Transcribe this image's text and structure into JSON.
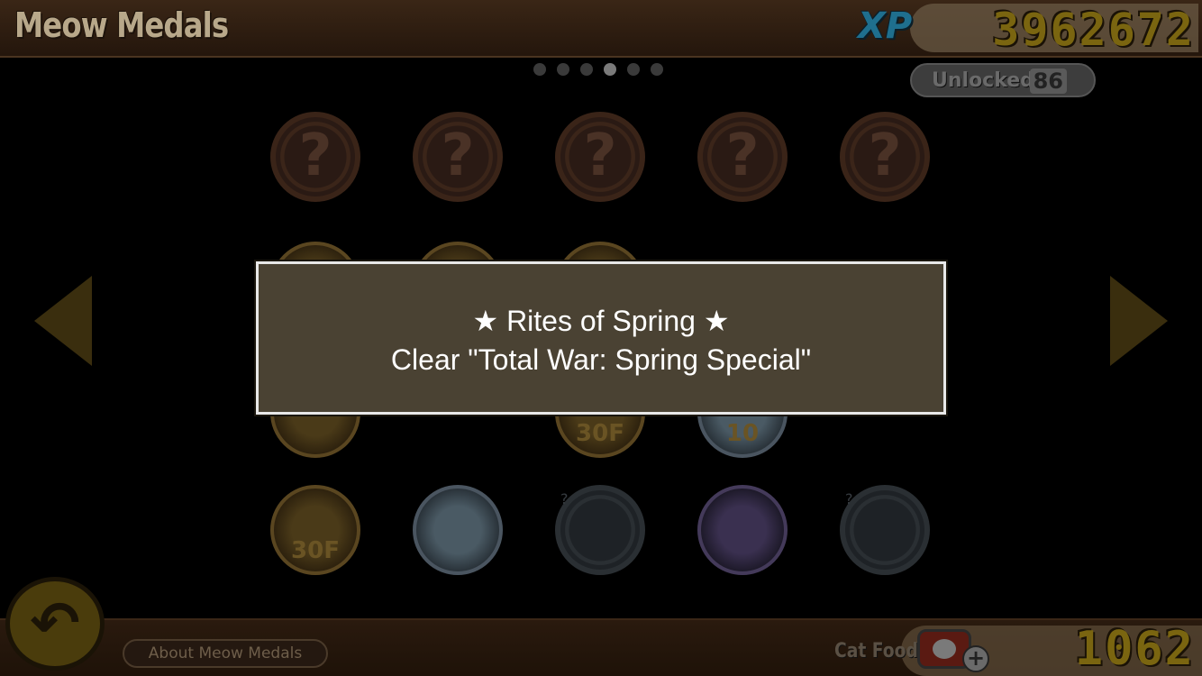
{
  "header": {
    "title": "Meow Medals",
    "xp_label": "XP",
    "xp_value": "3962672"
  },
  "pager": {
    "pages": 6,
    "active_index": 3
  },
  "unlocked": {
    "label": "Unlocked",
    "count": "86"
  },
  "medals": [
    {
      "state": "locked",
      "symbol": "?"
    },
    {
      "state": "locked",
      "symbol": "?"
    },
    {
      "state": "locked",
      "symbol": "?"
    },
    {
      "state": "locked",
      "symbol": "?"
    },
    {
      "state": "locked",
      "symbol": "?"
    },
    {
      "state": "gold",
      "symbol": ""
    },
    {
      "state": "gold",
      "symbol": ""
    },
    {
      "state": "gold",
      "symbol": ""
    },
    {
      "state": "hidden",
      "symbol": ""
    },
    {
      "state": "hidden",
      "symbol": ""
    },
    {
      "state": "gold",
      "symbol": ""
    },
    {
      "state": "hidden",
      "symbol": ""
    },
    {
      "state": "gold",
      "symbol": "30F"
    },
    {
      "state": "silver",
      "symbol": "10"
    },
    {
      "state": "hidden",
      "symbol": ""
    },
    {
      "state": "gold",
      "symbol": "30F"
    },
    {
      "state": "silver",
      "symbol": ""
    },
    {
      "state": "gray",
      "symbol": "?"
    },
    {
      "state": "purple",
      "symbol": ""
    },
    {
      "state": "gray",
      "symbol": "?"
    }
  ],
  "dialog": {
    "title": "★ Rites of Spring ★",
    "description": "Clear \"Total War: Spring Special\""
  },
  "footer": {
    "about_label": "About Meow Medals",
    "cat_food_label": "Cat Food",
    "cat_food_value": "1062",
    "plus_symbol": "+",
    "back_symbol": "↶"
  },
  "colors": {
    "accent_gold": "#7a6510",
    "xp_blue": "#1f6f8e",
    "dialog_bg": "#4a4233",
    "dialog_border": "#e8e8e8"
  }
}
